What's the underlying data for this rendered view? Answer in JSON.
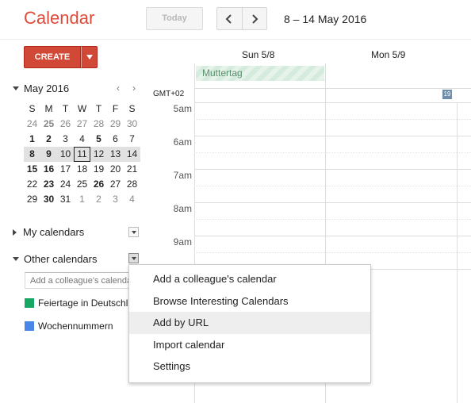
{
  "app": {
    "title": "Calendar"
  },
  "toolbar": {
    "today_label": "Today",
    "prev_icon": "chevron-left",
    "next_icon": "chevron-right",
    "date_range": "8 – 14 May 2016"
  },
  "create": {
    "label": "CREATE"
  },
  "mini_calendar": {
    "title": "May 2016",
    "prev": "‹",
    "next": "›",
    "weekday_headers": [
      "S",
      "M",
      "T",
      "W",
      "T",
      "F",
      "S"
    ],
    "weeks": [
      [
        {
          "d": "24",
          "o": true
        },
        {
          "d": "25",
          "o": true,
          "b": true
        },
        {
          "d": "26",
          "o": true
        },
        {
          "d": "27",
          "o": true
        },
        {
          "d": "28",
          "o": true
        },
        {
          "d": "29",
          "o": true
        },
        {
          "d": "30",
          "o": true
        }
      ],
      [
        {
          "d": "1",
          "b": true
        },
        {
          "d": "2",
          "b": true
        },
        {
          "d": "3"
        },
        {
          "d": "4"
        },
        {
          "d": "5",
          "b": true
        },
        {
          "d": "6"
        },
        {
          "d": "7"
        }
      ],
      [
        {
          "d": "8",
          "b": true
        },
        {
          "d": "9",
          "b": true
        },
        {
          "d": "10"
        },
        {
          "d": "11",
          "t": true
        },
        {
          "d": "12"
        },
        {
          "d": "13"
        },
        {
          "d": "14"
        }
      ],
      [
        {
          "d": "15",
          "b": true
        },
        {
          "d": "16",
          "b": true
        },
        {
          "d": "17"
        },
        {
          "d": "18"
        },
        {
          "d": "19"
        },
        {
          "d": "20"
        },
        {
          "d": "21"
        }
      ],
      [
        {
          "d": "22"
        },
        {
          "d": "23",
          "b": true
        },
        {
          "d": "24"
        },
        {
          "d": "25"
        },
        {
          "d": "26",
          "b": true
        },
        {
          "d": "27"
        },
        {
          "d": "28"
        }
      ],
      [
        {
          "d": "29"
        },
        {
          "d": "30",
          "b": true
        },
        {
          "d": "31"
        },
        {
          "d": "1",
          "o": true
        },
        {
          "d": "2",
          "o": true
        },
        {
          "d": "3",
          "o": true
        },
        {
          "d": "4",
          "o": true
        }
      ]
    ],
    "selected_week_index": 2
  },
  "sidebar": {
    "my_calendars": "My calendars",
    "other_calendars": "Other calendars",
    "colleague_placeholder": "Add a colleague's calendar",
    "calendars": [
      {
        "name": "Feiertage in Deutschland",
        "color": "#16a765"
      },
      {
        "name": "Wochennummern",
        "color": "#4986e7"
      }
    ]
  },
  "grid": {
    "columns": [
      "Sun 5/8",
      "Mon 5/9"
    ],
    "timezone": "GMT+02",
    "calendar_icon_label": "19",
    "allday_events": [
      {
        "title": "Muttertag",
        "day": "Sun 5/8"
      }
    ],
    "hours": [
      "5am",
      "6am",
      "7am",
      "8am",
      "9am"
    ]
  },
  "menu": {
    "items": [
      {
        "label": "Add a colleague's calendar"
      },
      {
        "label": "Browse Interesting Calendars"
      },
      {
        "label": "Add by URL",
        "hover": true
      },
      {
        "label": "Import calendar"
      },
      {
        "label": "Settings"
      }
    ]
  }
}
